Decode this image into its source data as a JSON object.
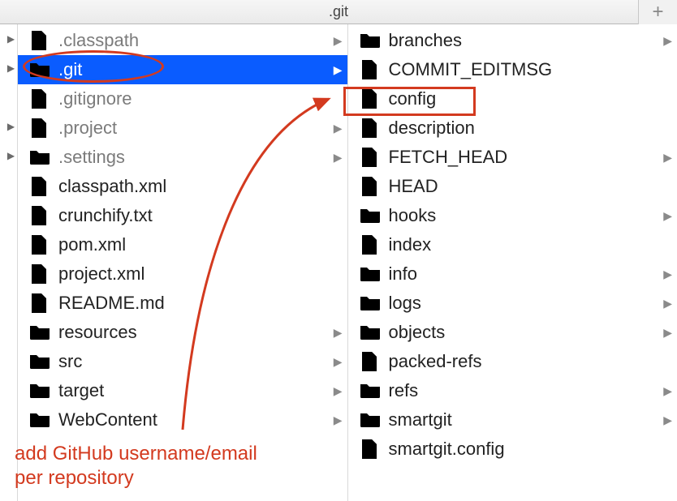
{
  "window": {
    "title": ".git",
    "plus_label": "+"
  },
  "left": {
    "items": [
      {
        "name": ".classpath",
        "icon": "file",
        "dimmed": true,
        "expandable": true,
        "left_chev": true
      },
      {
        "name": ".git",
        "icon": "folder",
        "dimmed": true,
        "expandable": true,
        "left_chev": true,
        "selected": true
      },
      {
        "name": ".gitignore",
        "icon": "file",
        "dimmed": true,
        "expandable": false,
        "left_chev": false
      },
      {
        "name": ".project",
        "icon": "file",
        "dimmed": true,
        "expandable": true,
        "left_chev": true
      },
      {
        "name": ".settings",
        "icon": "folder",
        "dimmed": true,
        "expandable": true,
        "left_chev": true
      },
      {
        "name": "classpath.xml",
        "icon": "xml",
        "dimmed": false,
        "expandable": false,
        "left_chev": false
      },
      {
        "name": "crunchify.txt",
        "icon": "txt",
        "dimmed": false,
        "expandable": false,
        "left_chev": false
      },
      {
        "name": "pom.xml",
        "icon": "xml",
        "dimmed": false,
        "expandable": false,
        "left_chev": false
      },
      {
        "name": "project.xml",
        "icon": "xml",
        "dimmed": false,
        "expandable": false,
        "left_chev": false
      },
      {
        "name": "README.md",
        "icon": "xml",
        "dimmed": false,
        "expandable": false,
        "left_chev": false
      },
      {
        "name": "resources",
        "icon": "folder",
        "dimmed": false,
        "expandable": true,
        "left_chev": false
      },
      {
        "name": "src",
        "icon": "folder",
        "dimmed": false,
        "expandable": true,
        "left_chev": false
      },
      {
        "name": "target",
        "icon": "folder",
        "dimmed": false,
        "expandable": true,
        "left_chev": false
      },
      {
        "name": "WebContent",
        "icon": "folder",
        "dimmed": false,
        "expandable": true,
        "left_chev": false
      }
    ]
  },
  "right": {
    "items": [
      {
        "name": "branches",
        "icon": "folder",
        "expandable": true
      },
      {
        "name": "COMMIT_EDITMSG",
        "icon": "file",
        "expandable": false
      },
      {
        "name": "config",
        "icon": "file",
        "expandable": false,
        "highlight": true
      },
      {
        "name": "description",
        "icon": "file",
        "expandable": false
      },
      {
        "name": "FETCH_HEAD",
        "icon": "file",
        "expandable": true
      },
      {
        "name": "HEAD",
        "icon": "file",
        "expandable": false
      },
      {
        "name": "hooks",
        "icon": "folder",
        "expandable": true
      },
      {
        "name": "index",
        "icon": "file",
        "expandable": false
      },
      {
        "name": "info",
        "icon": "folder",
        "expandable": true
      },
      {
        "name": "logs",
        "icon": "folder",
        "expandable": true
      },
      {
        "name": "objects",
        "icon": "folder",
        "expandable": true
      },
      {
        "name": "packed-refs",
        "icon": "file",
        "expandable": false
      },
      {
        "name": "refs",
        "icon": "folder",
        "expandable": true
      },
      {
        "name": "smartgit",
        "icon": "folder",
        "expandable": true
      },
      {
        "name": "smartgit.config",
        "icon": "file",
        "expandable": false
      }
    ]
  },
  "annotation": {
    "text": "add GitHub username/email\nper repository"
  }
}
